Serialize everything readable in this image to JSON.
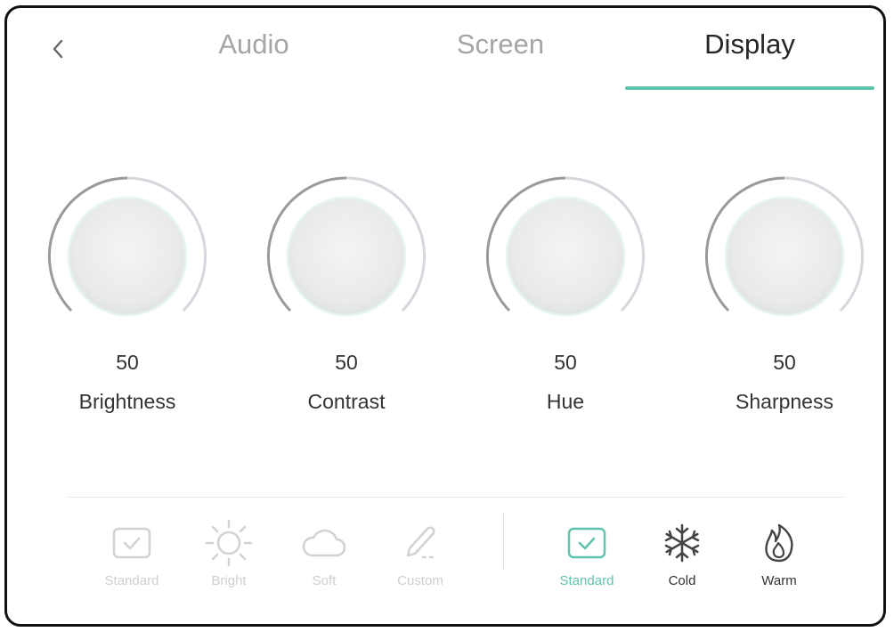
{
  "tabs": [
    {
      "label": "Audio",
      "active": false
    },
    {
      "label": "Screen",
      "active": false
    },
    {
      "label": "Display",
      "active": true
    }
  ],
  "colors": {
    "accent": "#5fc3ad",
    "text": "#333333",
    "inactive": "#a5a5a5",
    "dim": "#cfcfcf"
  },
  "knobs": [
    {
      "value": "50",
      "label": "Brightness"
    },
    {
      "value": "50",
      "label": "Contrast"
    },
    {
      "value": "50",
      "label": "Hue"
    },
    {
      "value": "50",
      "label": "Sharpness"
    }
  ],
  "picture_modes": [
    {
      "label": "Standard",
      "icon": "checkbox-icon"
    },
    {
      "label": "Bright",
      "icon": "sun-icon"
    },
    {
      "label": "Soft",
      "icon": "cloud-icon"
    },
    {
      "label": "Custom",
      "icon": "pencil-icon"
    }
  ],
  "color_temps": [
    {
      "label": "Standard",
      "icon": "checkbox-icon",
      "selected": true
    },
    {
      "label": "Cold",
      "icon": "snowflake-icon",
      "selected": false
    },
    {
      "label": "Warm",
      "icon": "flame-icon",
      "selected": false
    }
  ]
}
